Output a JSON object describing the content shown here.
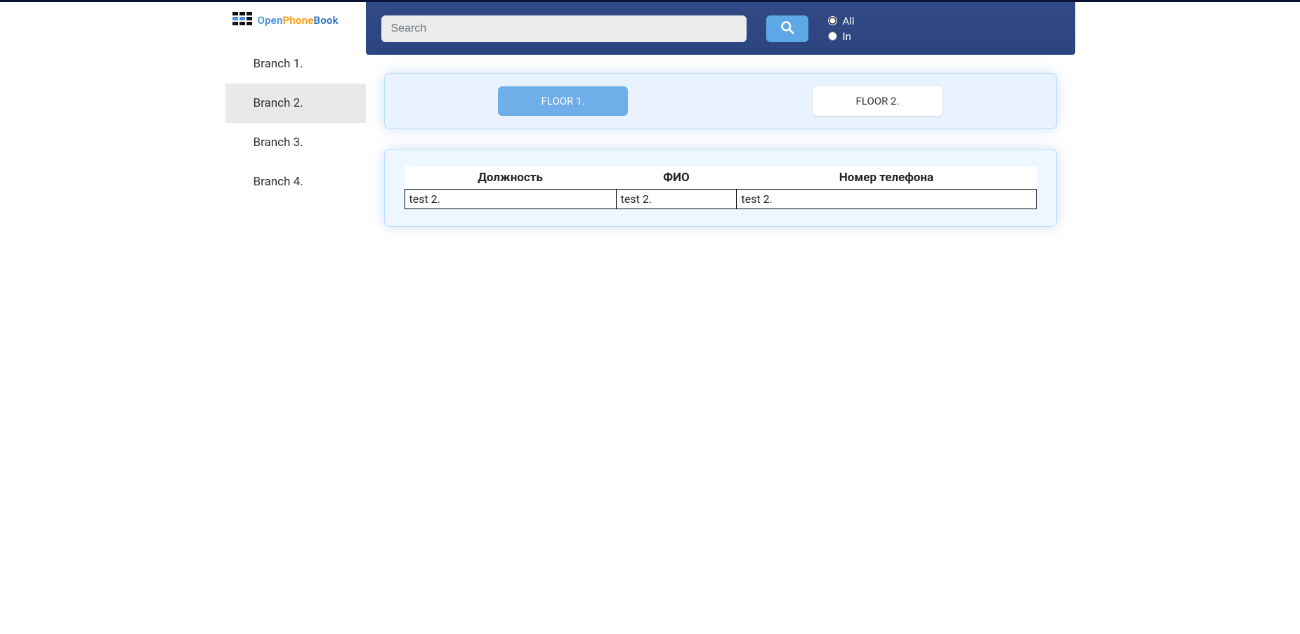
{
  "logo": {
    "open": "Open",
    "phone": "Phone",
    "book": "Book"
  },
  "sidebar": {
    "items": [
      {
        "label": "Branch 1.",
        "active": false
      },
      {
        "label": "Branch 2.",
        "active": true
      },
      {
        "label": "Branch 3.",
        "active": false
      },
      {
        "label": "Branch 4.",
        "active": false
      }
    ]
  },
  "topbar": {
    "search_placeholder": "Search",
    "radio": {
      "all": "All",
      "in": "In",
      "selected": "all"
    }
  },
  "floors": [
    {
      "label": "FLOOR 1.",
      "active": true
    },
    {
      "label": "FLOOR 2.",
      "active": false
    }
  ],
  "table": {
    "headers": [
      "Должность",
      "ФИО",
      "Номер телефона"
    ],
    "rows": [
      [
        "test 2.",
        "test 2.",
        "test 2."
      ]
    ]
  }
}
